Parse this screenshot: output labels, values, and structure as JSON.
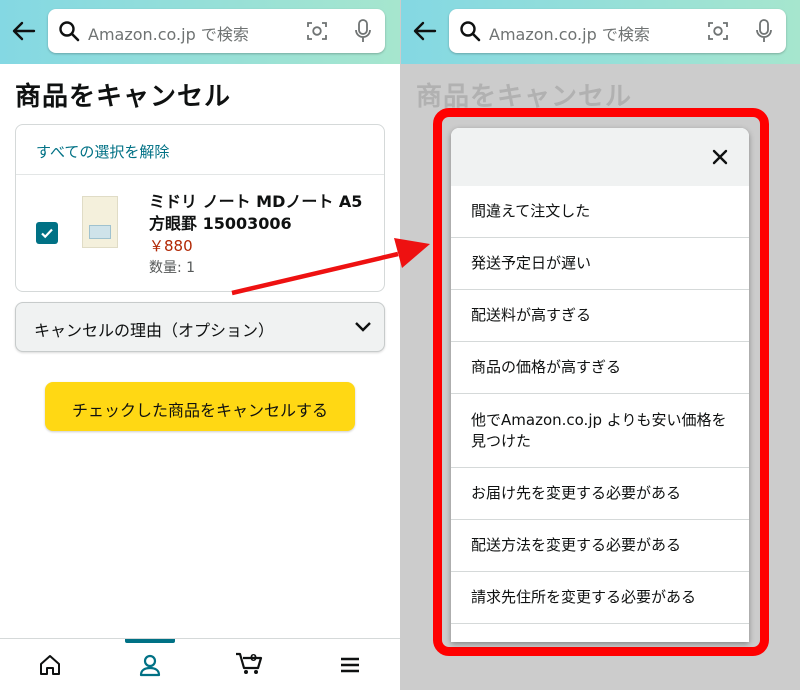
{
  "search": {
    "placeholder": "Amazon.co.jp で検索"
  },
  "page": {
    "title": "商品をキャンセル"
  },
  "order": {
    "deselect_all": "すべての選択を解除",
    "item": {
      "name": "ミドリ ノート MDノート A5 方眼罫 15003006",
      "price": "￥880",
      "quantity": "数量: 1",
      "checked": true
    }
  },
  "reason_dropdown": {
    "label": "キャンセルの理由（オプション）"
  },
  "cancel_button": {
    "label": "チェックした商品をキャンセルする"
  },
  "bottom_nav": {
    "items": [
      "home-icon",
      "account-icon",
      "cart-icon",
      "menu-icon"
    ],
    "cart_count": "0",
    "active": "account"
  },
  "modal": {
    "reasons": [
      "間違えて注文した",
      "発送予定日が遅い",
      "配送料が高すぎる",
      "商品の価格が高すぎる",
      "他でAmazon.co.jp よりも安い価格を見つけた",
      "お届け先を変更する必要がある",
      "配送方法を変更する必要がある",
      "請求先住所を変更する必要がある"
    ]
  },
  "colors": {
    "accent": "#007185",
    "button": "#ffd814",
    "price": "#b12704",
    "highlight": "#ff0000"
  }
}
